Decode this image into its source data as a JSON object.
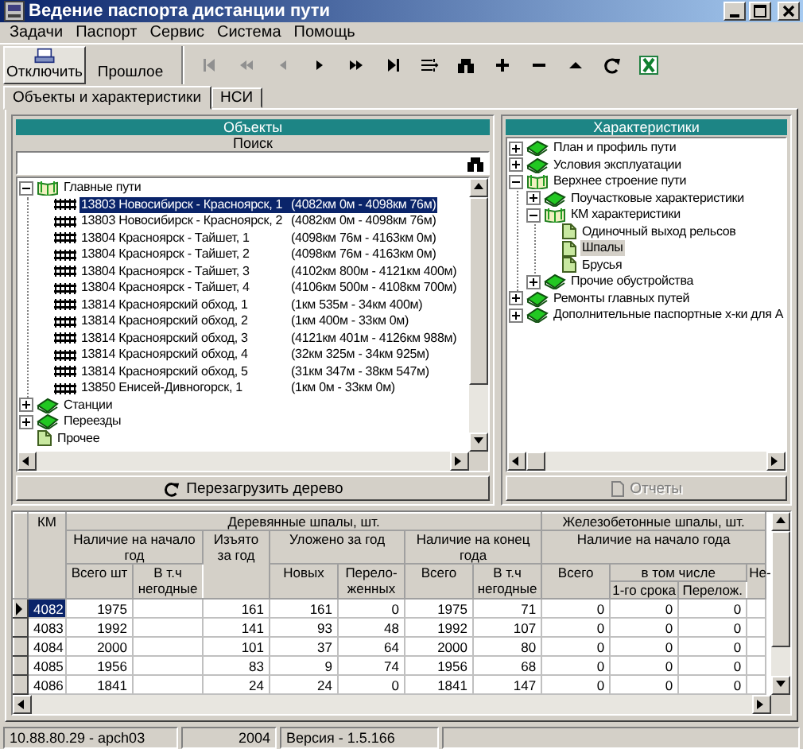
{
  "window": {
    "title": "Ведение паспорта дистанции пути"
  },
  "menu": [
    "Задачи",
    "Паспорт",
    "Сервис",
    "Система",
    "Помощь"
  ],
  "toolbar": {
    "buttons": [
      {
        "label": "Отключить",
        "kind": "disconnect"
      },
      {
        "label": "Прошлое",
        "kind": "history"
      }
    ],
    "nav": [
      {
        "kind": "first",
        "disabled": true
      },
      {
        "kind": "prev-page",
        "disabled": true
      },
      {
        "kind": "prev",
        "disabled": true
      },
      {
        "kind": "next",
        "disabled": false
      },
      {
        "kind": "next-page",
        "disabled": false
      },
      {
        "kind": "last",
        "disabled": false
      },
      {
        "kind": "columns",
        "disabled": false
      },
      {
        "kind": "binoculars",
        "disabled": false
      },
      {
        "kind": "plus",
        "disabled": false
      },
      {
        "kind": "minus",
        "disabled": false
      },
      {
        "kind": "up",
        "disabled": false
      },
      {
        "kind": "refresh",
        "disabled": false
      },
      {
        "kind": "excel",
        "disabled": false
      }
    ]
  },
  "tabs": [
    {
      "label": "Объекты и характеристики",
      "selected": true
    },
    {
      "label": "НСИ",
      "selected": false
    }
  ],
  "objects": {
    "title": "Объекты",
    "search_label": "Поиск",
    "reload_button": "Перезагрузить дерево",
    "tree": [
      {
        "kind": "open-book",
        "label": "Главные пути",
        "expanded": true,
        "selected": false,
        "children": [
          {
            "kind": "track",
            "label": "13803 Новосибирск - Красноярск, 1",
            "range": "(4082км 0м - 4098км 76м)",
            "selected": true
          },
          {
            "kind": "track",
            "label": "13803 Новосибирск - Красноярск, 2",
            "range": "(4082км 0м - 4098км 76м)",
            "selected": false
          },
          {
            "kind": "track",
            "label": "13804 Красноярск - Тайшет, 1",
            "range": "(4098км 76м - 4163км 0м)",
            "selected": false
          },
          {
            "kind": "track",
            "label": "13804 Красноярск - Тайшет, 2",
            "range": "(4098км 76м - 4163км 0м)",
            "selected": false
          },
          {
            "kind": "track",
            "label": "13804 Красноярск - Тайшет, 3",
            "range": "(4102км 800м - 4121км 400м)",
            "selected": false
          },
          {
            "kind": "track",
            "label": "13804 Красноярск - Тайшет, 4",
            "range": "(4106км 500м - 4108км 700м)",
            "selected": false
          },
          {
            "kind": "track",
            "label": "13814 Красноярский обход, 1",
            "range": "(1км 535м - 34км 400м)",
            "selected": false
          },
          {
            "kind": "track",
            "label": "13814 Красноярский обход, 2",
            "range": "(1км 400м - 33км 0м)",
            "selected": false
          },
          {
            "kind": "track",
            "label": "13814 Красноярский обход, 3",
            "range": "(4121км 401м - 4126км 988м)",
            "selected": false
          },
          {
            "kind": "track",
            "label": "13814 Красноярский обход, 4",
            "range": "(32км 325м - 34км 925м)",
            "selected": false
          },
          {
            "kind": "track",
            "label": "13814 Красноярский обход, 5",
            "range": "(31км 347м - 38км 547м)",
            "selected": false
          },
          {
            "kind": "track",
            "label": "13850 Енисей-Дивногорск, 1",
            "range": "(1км 0м - 33км 0м)",
            "selected": false
          }
        ]
      },
      {
        "kind": "book",
        "label": "Станции",
        "expanded": false,
        "selected": false
      },
      {
        "kind": "book",
        "label": "Переезды",
        "expanded": false,
        "selected": false
      },
      {
        "kind": "page",
        "label": "Прочее",
        "selected": false
      }
    ]
  },
  "characteristics": {
    "title": "Характеристики",
    "reports_button": {
      "label": "Отчеты",
      "disabled": true
    },
    "tree": [
      {
        "kind": "book",
        "label": "План и профиль пути",
        "expanded": false,
        "selected": false
      },
      {
        "kind": "book",
        "label": "Условия эксплуатации",
        "expanded": false,
        "selected": false
      },
      {
        "kind": "open-book",
        "label": "Верхнее строение пути",
        "expanded": true,
        "selected": false,
        "children": [
          {
            "kind": "book",
            "label": "Поучастковые характеристики",
            "expanded": false,
            "selected": false
          },
          {
            "kind": "open-book",
            "label": "КМ характеристики",
            "expanded": true,
            "selected": false,
            "children": [
              {
                "kind": "page",
                "label": "Одиночный выход рельсов",
                "selected": false
              },
              {
                "kind": "page",
                "label": "Шпалы",
                "selected": true
              },
              {
                "kind": "page",
                "label": "Брусья",
                "selected": false
              }
            ]
          },
          {
            "kind": "book",
            "label": "Прочие обустройства",
            "expanded": false,
            "selected": false
          }
        ]
      },
      {
        "kind": "book",
        "label": "Ремонты главных путей",
        "expanded": false,
        "selected": false
      },
      {
        "kind": "book",
        "label": "Дополнительные паспортные х-ки для А",
        "expanded": false,
        "selected": false
      }
    ]
  },
  "table": {
    "header_rows": [
      [
        {
          "text": "КМ",
          "rowspan": 4
        },
        {
          "text": "Деревянные шпалы, шт.",
          "colspan": 7
        },
        {
          "text": "Железобетонные шпалы, шт.",
          "colspan": 4
        }
      ],
      [
        {
          "text": "Наличие на начало год",
          "colspan": 2
        },
        {
          "text": "Изъято за год",
          "rowspan": 3
        },
        {
          "text": "Уложено за год",
          "colspan": 2
        },
        {
          "text": "Наличие на конец года",
          "colspan": 2
        },
        {
          "text": "Наличие на начало года",
          "colspan": 4
        }
      ],
      [
        {
          "text": "Всего шт",
          "rowspan": 2
        },
        {
          "text": "В т.ч негодные",
          "rowspan": 2
        },
        {
          "text": "Новых",
          "rowspan": 2
        },
        {
          "text": "Перело-женных",
          "rowspan": 2
        },
        {
          "text": "Всего",
          "rowspan": 2
        },
        {
          "text": "В т.ч негодные",
          "rowspan": 2
        },
        {
          "text": "Всего",
          "rowspan": 2
        },
        {
          "text": "в том числе",
          "colspan": 2
        },
        {
          "text": "Не-",
          "rowspan": 2
        }
      ],
      [
        {
          "text": "1-го срока"
        },
        {
          "text": "Перелож."
        }
      ]
    ],
    "rows": [
      {
        "selected": true,
        "cells": [
          "4082",
          "1975",
          null,
          "161",
          "161",
          "0",
          "1975",
          "71",
          "0",
          "0",
          "0",
          null
        ]
      },
      {
        "selected": false,
        "cells": [
          "4083",
          "1992",
          null,
          "141",
          "93",
          "48",
          "1992",
          "107",
          "0",
          "0",
          "0",
          null
        ]
      },
      {
        "selected": false,
        "cells": [
          "4084",
          "2000",
          null,
          "101",
          "37",
          "64",
          "2000",
          "80",
          "0",
          "0",
          "0",
          null
        ]
      },
      {
        "selected": false,
        "cells": [
          "4085",
          "1956",
          null,
          "83",
          "9",
          "74",
          "1956",
          "68",
          "0",
          "0",
          "0",
          null
        ]
      },
      {
        "selected": false,
        "cells": [
          "4086",
          "1841",
          null,
          "24",
          "24",
          "0",
          "1841",
          "147",
          "0",
          "0",
          "0",
          null
        ]
      }
    ]
  },
  "status_bar": [
    "10.88.80.29 - apch03",
    "2004",
    "Версия - 1.5.166"
  ]
}
